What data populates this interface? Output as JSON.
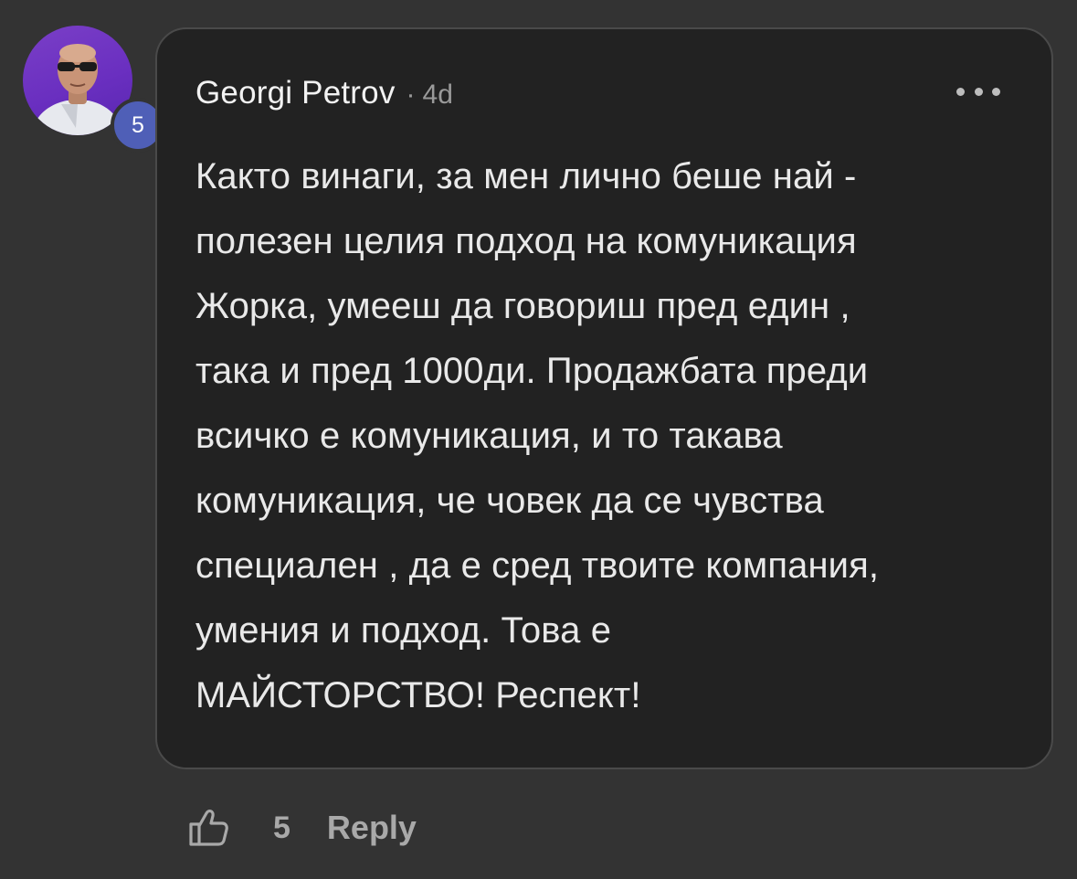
{
  "comment": {
    "author": "Georgi Petrov",
    "separator": "·",
    "time": "4d",
    "level": "5",
    "body": "Както винаги, за мен лично беше най -\nполезен целия подход на комуникация\nЖорка, умееш да говориш пред един ,\nтака и пред 1000ди. Продажбата преди\nвсичко е комуникация, и то такава\nкомуникация, че човек да се чувства\nспециален , да е сред твоите компания,\nумения и подход. Това е\nМАЙСТОРСТВО! Респект!",
    "more_icon": "more-horizontal-icon"
  },
  "actions": {
    "like_icon": "thumbs-up-icon",
    "like_count": "5",
    "reply_label": "Reply"
  },
  "colors": {
    "background": "#333333",
    "bubble": "#222222",
    "level_badge": "#4f5fb7",
    "avatar_bg": "#6a2fc0"
  }
}
